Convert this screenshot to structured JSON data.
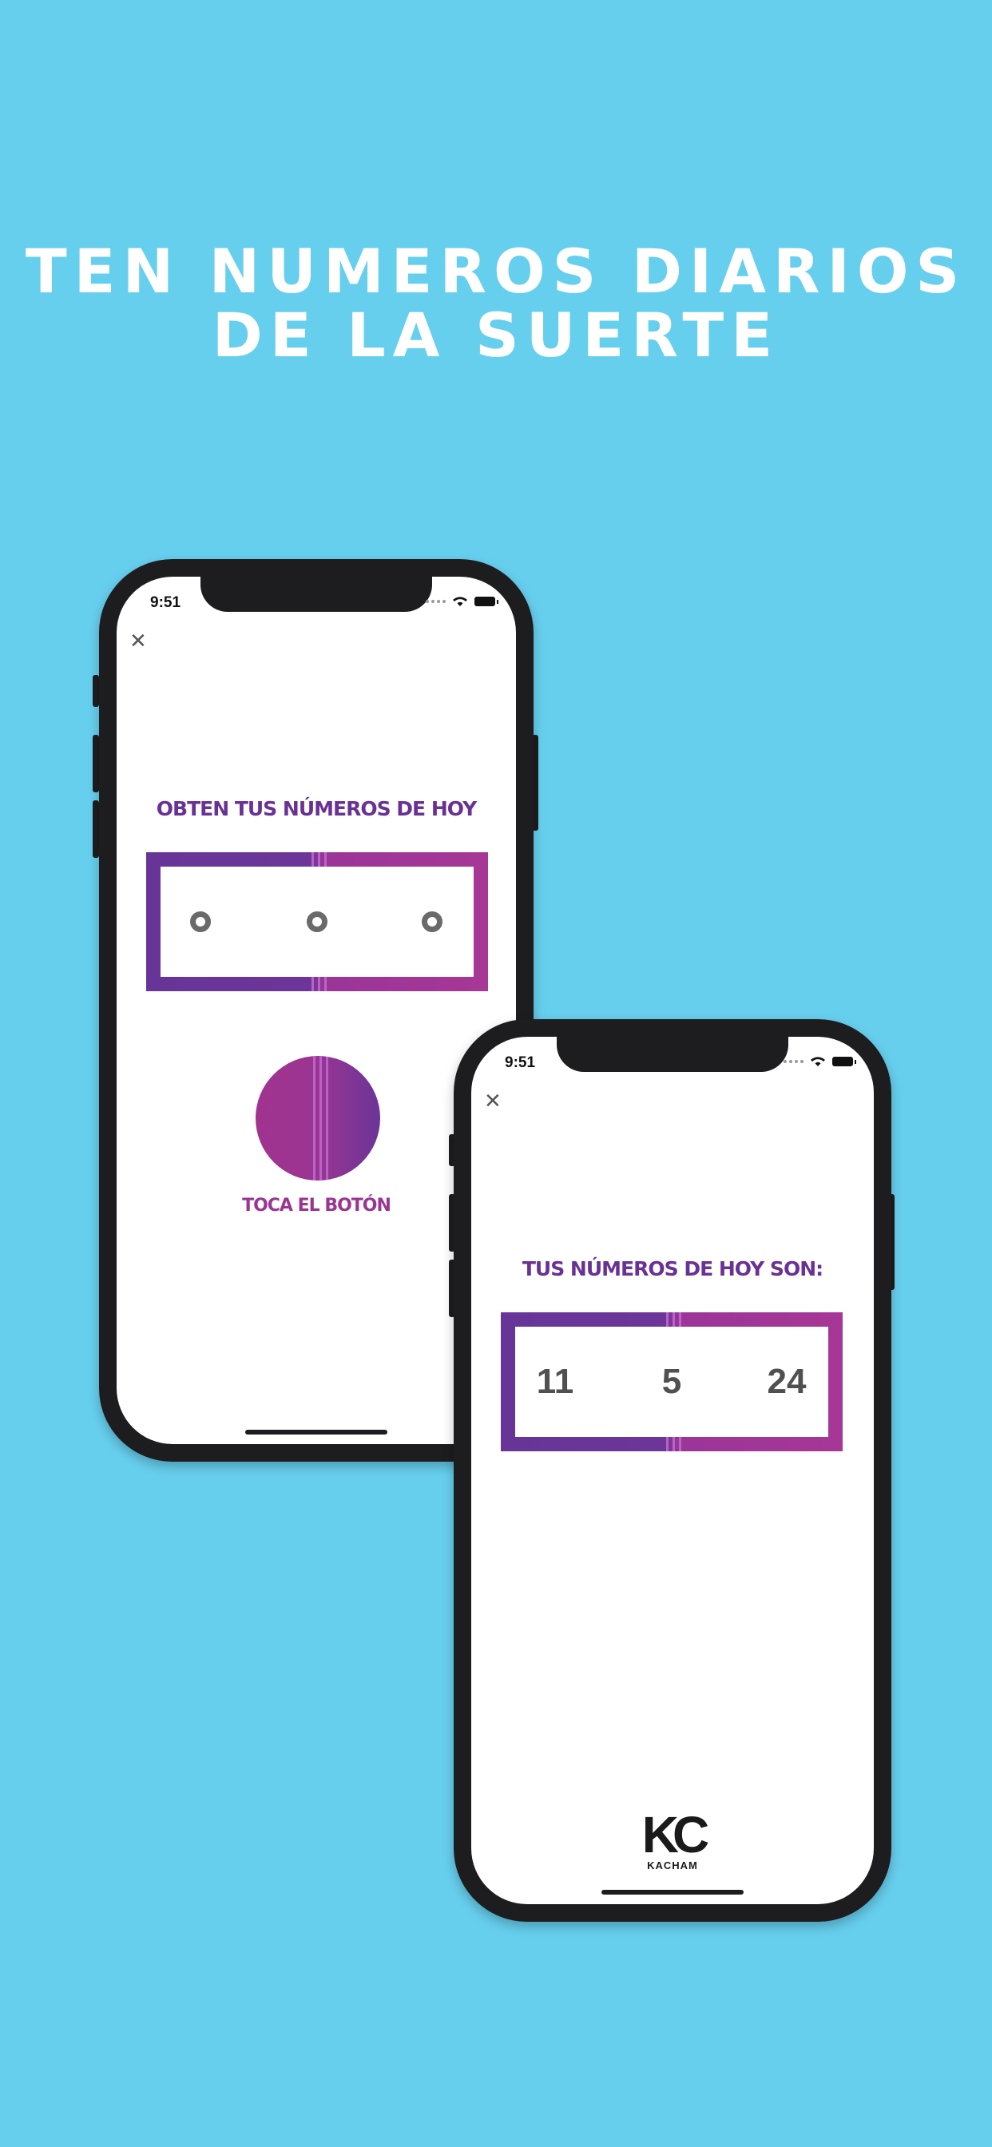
{
  "headline": {
    "line1": "TEN NUMEROS DIARIOS",
    "line2": "DE LA SUERTE"
  },
  "colors": {
    "background": "#67cfee",
    "purple": "#6a3194",
    "magenta": "#9a3592"
  },
  "phone_left": {
    "status_time": "9:51",
    "close_icon": "close-icon",
    "title": "OBTEN TUS NÚMEROS DE HOY",
    "slots": [
      "o",
      "o",
      "o"
    ],
    "button_label": "TOCA EL BOTÓN"
  },
  "phone_right": {
    "status_time": "9:51",
    "close_icon": "close-icon",
    "title": "TUS NÚMEROS DE HOY SON:",
    "numbers": [
      "11",
      "5",
      "24"
    ],
    "logo_text": "KACHAM"
  }
}
